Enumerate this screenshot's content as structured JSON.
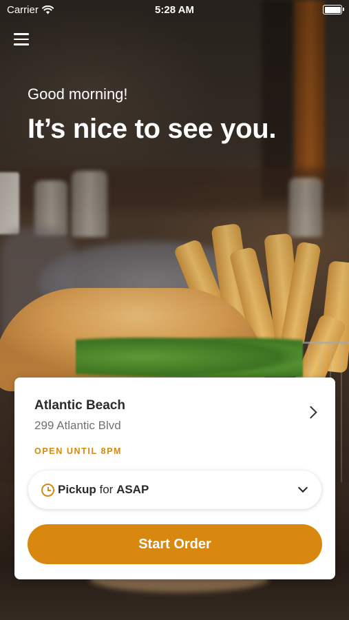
{
  "status_bar": {
    "carrier": "Carrier",
    "time": "5:28 AM",
    "wifi_icon": "wifi-icon",
    "battery_icon": "battery-icon"
  },
  "header": {
    "menu_icon": "hamburger-menu-icon",
    "greeting": "Good morning!",
    "headline": "It’s nice to see you."
  },
  "store_card": {
    "name": "Atlantic Beach",
    "address": "299 Atlantic Blvd",
    "hours": "OPEN UNTIL 8PM",
    "chevron_icon": "chevron-right-icon",
    "order_mode": {
      "icon": "clock-icon",
      "method": "Pickup",
      "connector": "for",
      "timing": "ASAP",
      "dropdown_icon": "chevron-down-icon"
    },
    "start_order_label": "Start Order"
  },
  "colors": {
    "accent": "#d8880e",
    "hours_text": "#d7880d",
    "card_bg": "#ffffff"
  }
}
